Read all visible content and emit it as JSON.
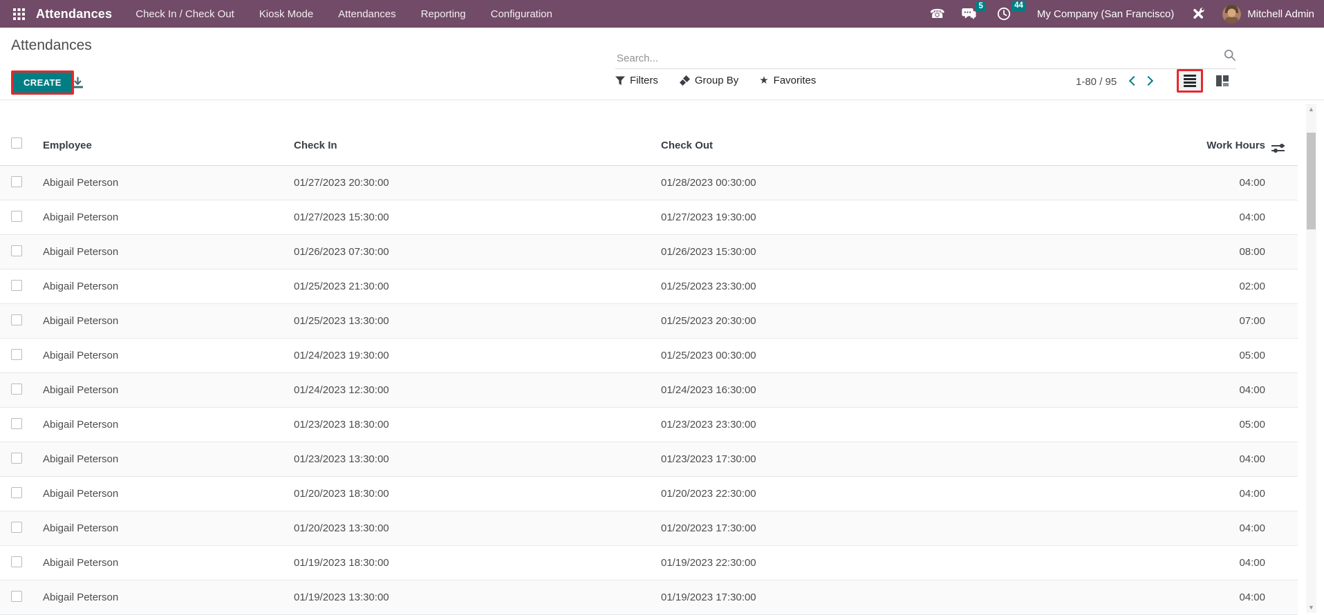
{
  "topbar": {
    "app_name": "Attendances",
    "menu": [
      "Check In / Check Out",
      "Kiosk Mode",
      "Attendances",
      "Reporting",
      "Configuration"
    ],
    "messages_badge": "5",
    "activities_badge": "44",
    "company_name": "My Company (San Francisco)",
    "user_name": "Mitchell Admin"
  },
  "control_panel": {
    "title": "Attendances",
    "search_placeholder": "Search...",
    "create_label": "CREATE",
    "filters_label": "Filters",
    "group_by_label": "Group By",
    "favorites_label": "Favorites",
    "pager_text": "1-80 / 95"
  },
  "table": {
    "columns": [
      "Employee",
      "Check In",
      "Check Out",
      "Work Hours"
    ],
    "rows": [
      {
        "employee": "Abigail Peterson",
        "check_in": "01/27/2023 20:30:00",
        "check_out": "01/28/2023 00:30:00",
        "work_hours": "04:00"
      },
      {
        "employee": "Abigail Peterson",
        "check_in": "01/27/2023 15:30:00",
        "check_out": "01/27/2023 19:30:00",
        "work_hours": "04:00"
      },
      {
        "employee": "Abigail Peterson",
        "check_in": "01/26/2023 07:30:00",
        "check_out": "01/26/2023 15:30:00",
        "work_hours": "08:00"
      },
      {
        "employee": "Abigail Peterson",
        "check_in": "01/25/2023 21:30:00",
        "check_out": "01/25/2023 23:30:00",
        "work_hours": "02:00"
      },
      {
        "employee": "Abigail Peterson",
        "check_in": "01/25/2023 13:30:00",
        "check_out": "01/25/2023 20:30:00",
        "work_hours": "07:00"
      },
      {
        "employee": "Abigail Peterson",
        "check_in": "01/24/2023 19:30:00",
        "check_out": "01/25/2023 00:30:00",
        "work_hours": "05:00"
      },
      {
        "employee": "Abigail Peterson",
        "check_in": "01/24/2023 12:30:00",
        "check_out": "01/24/2023 16:30:00",
        "work_hours": "04:00"
      },
      {
        "employee": "Abigail Peterson",
        "check_in": "01/23/2023 18:30:00",
        "check_out": "01/23/2023 23:30:00",
        "work_hours": "05:00"
      },
      {
        "employee": "Abigail Peterson",
        "check_in": "01/23/2023 13:30:00",
        "check_out": "01/23/2023 17:30:00",
        "work_hours": "04:00"
      },
      {
        "employee": "Abigail Peterson",
        "check_in": "01/20/2023 18:30:00",
        "check_out": "01/20/2023 22:30:00",
        "work_hours": "04:00"
      },
      {
        "employee": "Abigail Peterson",
        "check_in": "01/20/2023 13:30:00",
        "check_out": "01/20/2023 17:30:00",
        "work_hours": "04:00"
      },
      {
        "employee": "Abigail Peterson",
        "check_in": "01/19/2023 18:30:00",
        "check_out": "01/19/2023 22:30:00",
        "work_hours": "04:00"
      },
      {
        "employee": "Abigail Peterson",
        "check_in": "01/19/2023 13:30:00",
        "check_out": "01/19/2023 17:30:00",
        "work_hours": "04:00"
      }
    ]
  },
  "colors": {
    "topbar_bg": "#714B67",
    "accent_teal": "#017E84",
    "annotation_red": "#E8272C",
    "row_stripe": "#FAFAFA"
  }
}
